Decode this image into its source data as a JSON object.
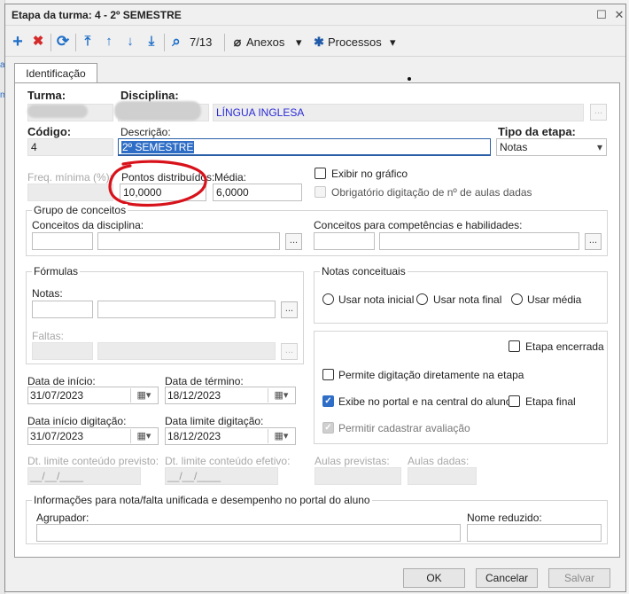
{
  "window": {
    "title": "Etapa da turma: 4 - 2º SEMESTRE",
    "maximize_symbol": "☐",
    "close_symbol": "✕"
  },
  "toolbar": {
    "add_icon": "+",
    "delete_icon": "✖",
    "refresh_icon": "⟳",
    "first_icon": "⤒",
    "prev_icon": "↑",
    "next_icon": "↓",
    "last_icon": "⤓",
    "search_icon": "⌕",
    "record_counter": "7/13",
    "attach_icon": "⌀",
    "attachments_label": "Anexos",
    "process_icon": "✱",
    "processes_label": "Processos",
    "dropdown_arrow": "▾"
  },
  "tab": {
    "label": "Identificação"
  },
  "form": {
    "turma_label": "Turma:",
    "disciplina_label": "Disciplina:",
    "disciplina_value": "LÍNGUA INGLESA",
    "codigo_label": "Código:",
    "codigo_value": "4",
    "descricao_label": "Descrição:",
    "descricao_value": "2º SEMESTRE",
    "tipo_etapa_label": "Tipo da etapa:",
    "tipo_etapa_value": "Notas",
    "freq_minima_label": "Freq. mínima (%):",
    "pontos_label": "Pontos distribuídos:",
    "pontos_value": "10,0000",
    "media_label": "Média:",
    "media_value": "6,0000",
    "exibir_grafico_label": "Exibir no gráfico",
    "obrigatorio_label": "Obrigatório digitação de nº de aulas dadas",
    "grupo_conceitos_title": "Grupo de conceitos",
    "conceitos_disciplina_label": "Conceitos da disciplina:",
    "conceitos_competencias_label": "Conceitos para competências e habilidades:",
    "formulas_title": "Fórmulas",
    "notas_label": "Notas:",
    "faltas_label": "Faltas:",
    "notas_conceituais_title": "Notas conceituais",
    "usar_nota_inicial": "Usar nota inicial",
    "usar_nota_final": "Usar nota final",
    "usar_media": "Usar média",
    "etapa_encerrada": "Etapa encerrada",
    "permite_digitacao": "Permite digitação diretamente na etapa",
    "exibe_portal": "Exibe no portal e na central do aluno",
    "etapa_final": "Etapa final",
    "permitir_avaliacao": "Permitir cadastrar avaliação",
    "data_inicio_label": "Data de início:",
    "data_inicio_value": "31/07/2023",
    "data_termino_label": "Data de término:",
    "data_termino_value": "18/12/2023",
    "data_inicio_dig_label": "Data início digitação:",
    "data_inicio_dig_value": "31/07/2023",
    "data_limite_dig_label": "Data limite digitação:",
    "data_limite_dig_value": "18/12/2023",
    "dt_limite_previsto_label": "Dt. limite conteúdo previsto:",
    "dt_limite_efetivo_label": "Dt. limite conteúdo efetivo:",
    "empty_date": "__/__/____",
    "aulas_previstas_label": "Aulas previstas:",
    "aulas_dadas_label": "Aulas dadas:",
    "info_group_title": "Informações para nota/falta unificada e desempenho no portal do aluno",
    "agrupador_label": "Agrupador:",
    "nome_reduzido_label": "Nome reduzido:",
    "ellipsis": "...",
    "calendar_icon": "▦▾",
    "check_mark": "✓"
  },
  "buttons": {
    "ok": "OK",
    "cancel": "Cancelar",
    "save": "Salvar"
  },
  "colors": {
    "accent": "#2f6ec6",
    "annotation": "#d8121b",
    "disciplina_text": "#2b2bd8"
  }
}
